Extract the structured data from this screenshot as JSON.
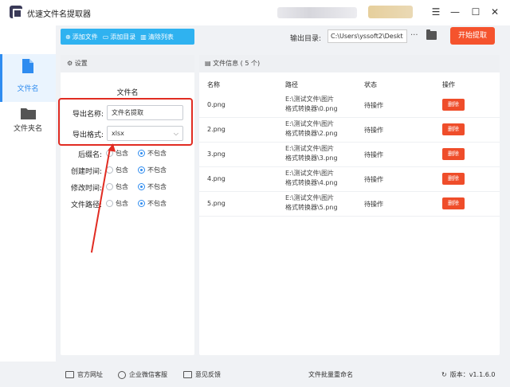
{
  "window": {
    "title": "优速文件名提取器",
    "minimize": "—",
    "maximize": "☐",
    "close": "✕",
    "menu": "☰"
  },
  "sidebar": {
    "items": [
      {
        "label": "文件名",
        "active": true
      },
      {
        "label": "文件夹名",
        "active": false
      }
    ]
  },
  "toolbar": {
    "add_file": "添加文件",
    "add_dir": "添加目录",
    "clear_list": "清除列表",
    "output_label": "输出目录:",
    "output_path": "C:\\Users\\yssoft2\\Deskt",
    "more": "···",
    "start": "开始提取"
  },
  "settings": {
    "header": "设置",
    "section_title": "文件名",
    "export_name_label": "导出名称:",
    "export_name_value": "文件名提取",
    "export_format_label": "导出格式:",
    "export_format_value": "xlsx",
    "options": [
      {
        "label": "后缀名:",
        "include": "包含",
        "exclude": "不包含",
        "selected": "exclude"
      },
      {
        "label": "创建时间:",
        "include": "包含",
        "exclude": "不包含",
        "selected": "exclude"
      },
      {
        "label": "修改时间:",
        "include": "包含",
        "exclude": "不包含",
        "selected": "exclude"
      },
      {
        "label": "文件路径:",
        "include": "包含",
        "exclude": "不包含",
        "selected": "exclude"
      }
    ]
  },
  "files": {
    "header": "文件信息 ( 5 个)",
    "columns": [
      "名称",
      "路径",
      "状态",
      "操作"
    ],
    "rows": [
      {
        "name": "0.png",
        "path1": "E:\\测试文件\\图片",
        "path2": "格式转换器\\0.png",
        "status": "待操作",
        "action": "删除"
      },
      {
        "name": "2.png",
        "path1": "E:\\测试文件\\图片",
        "path2": "格式转换器\\2.png",
        "status": "待操作",
        "action": "删除"
      },
      {
        "name": "3.png",
        "path1": "E:\\测试文件\\图片",
        "path2": "格式转换器\\3.png",
        "status": "待操作",
        "action": "删除"
      },
      {
        "name": "4.png",
        "path1": "E:\\测试文件\\图片",
        "path2": "格式转换器\\4.png",
        "status": "待操作",
        "action": "删除"
      },
      {
        "name": "5.png",
        "path1": "E:\\测试文件\\图片",
        "path2": "格式转换器\\5.png",
        "status": "待操作",
        "action": "删除"
      }
    ]
  },
  "footer": {
    "website": "官方网址",
    "wechat": "企业微信客服",
    "feedback": "意见反馈",
    "batch": "文件批量重命名",
    "version": "版本：v1.1.6.0"
  },
  "colors": {
    "accent": "#2fb2f0",
    "primary": "#2f8cf0",
    "danger": "#f5532d",
    "highlight": "#e12c22"
  }
}
